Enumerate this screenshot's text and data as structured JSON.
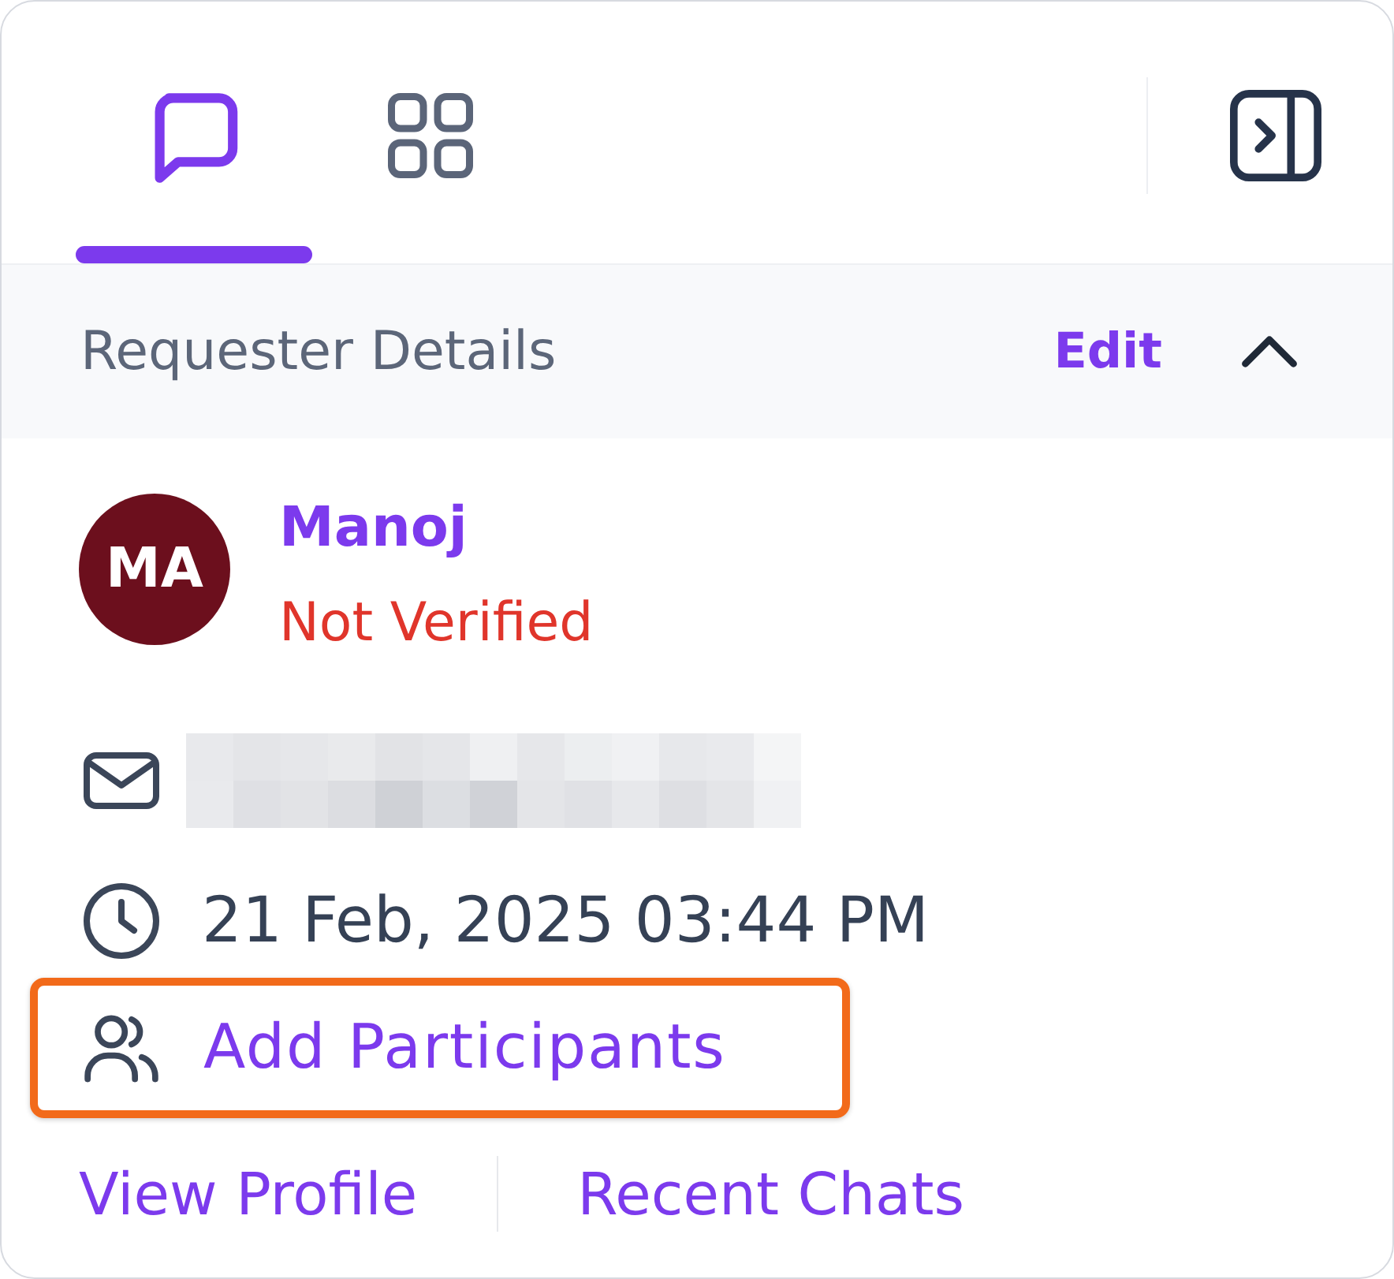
{
  "tabs": [
    {
      "kind": "chat",
      "selected": true
    },
    {
      "kind": "grid",
      "selected": false
    }
  ],
  "section": {
    "title": "Requester Details",
    "action": "Edit",
    "expanded": true
  },
  "requester": {
    "initials": "MA",
    "name": "Manoj",
    "status": "Not Verified",
    "verified": false
  },
  "details": [
    {
      "kind": "email",
      "redacted": true
    },
    {
      "kind": "time",
      "text": "21 Feb, 2025 03:44 PM"
    },
    {
      "kind": "participants",
      "text": "Add Participants",
      "highlighted": true
    }
  ],
  "links": [
    "View Profile",
    "Recent Chats"
  ]
}
